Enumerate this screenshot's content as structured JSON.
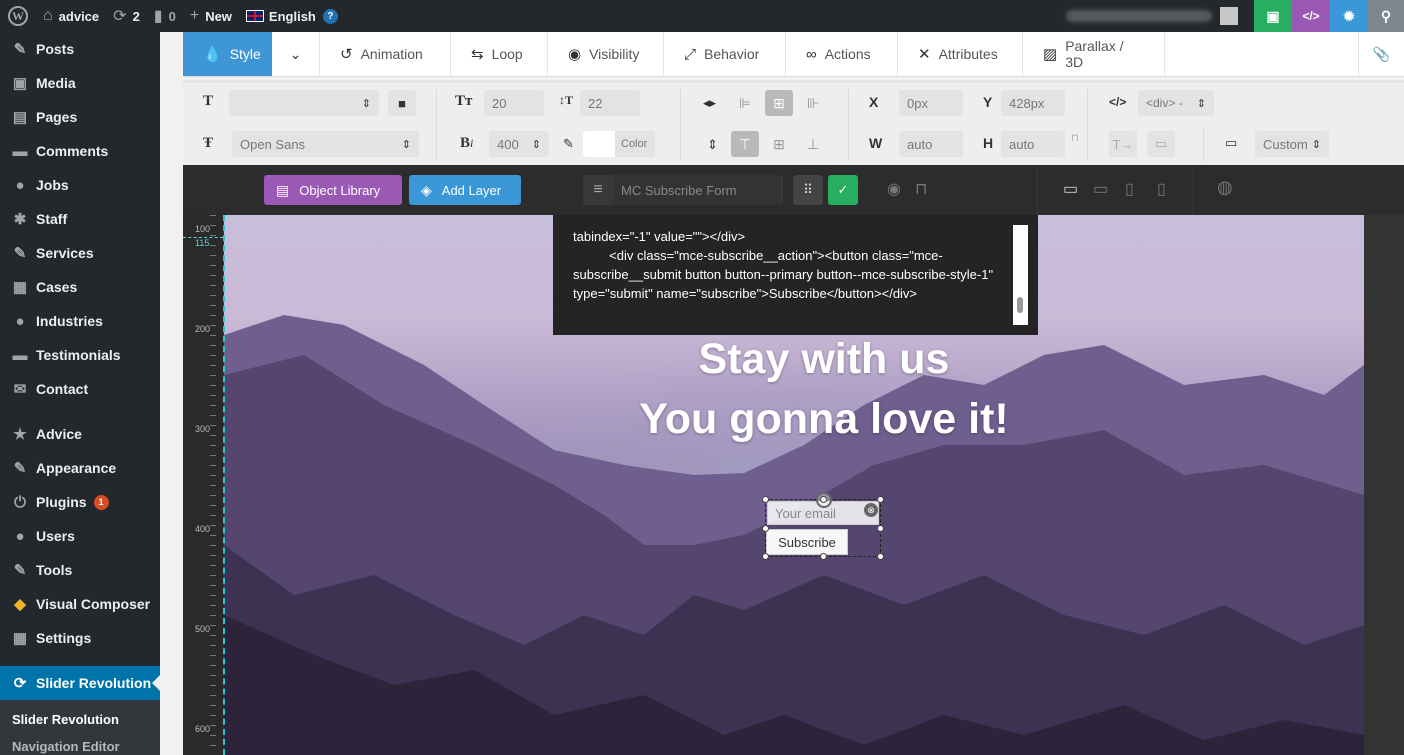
{
  "adminbar": {
    "site_name": "advice",
    "updates_count": "2",
    "comments_count": "0",
    "new_label": "New",
    "language_label": "English",
    "help_glyph": "?"
  },
  "sidebar": {
    "items": [
      {
        "label": "Posts",
        "icon": "pin-icon"
      },
      {
        "label": "Media",
        "icon": "media-icon"
      },
      {
        "label": "Pages",
        "icon": "pages-icon"
      },
      {
        "label": "Comments",
        "icon": "comments-icon"
      },
      {
        "label": "Jobs",
        "icon": "person-icon"
      },
      {
        "label": "Staff",
        "icon": "group-icon"
      },
      {
        "label": "Services",
        "icon": "wrench-icon"
      },
      {
        "label": "Cases",
        "icon": "cases-icon"
      },
      {
        "label": "Industries",
        "icon": "bulb-icon"
      },
      {
        "label": "Testimonials",
        "icon": "testimonials-icon"
      },
      {
        "label": "Contact",
        "icon": "mail-icon"
      },
      {
        "label": "Advice",
        "icon": "star-icon"
      },
      {
        "label": "Appearance",
        "icon": "brush-icon"
      },
      {
        "label": "Plugins",
        "icon": "plug-icon",
        "badge": "1"
      },
      {
        "label": "Users",
        "icon": "user-icon"
      },
      {
        "label": "Tools",
        "icon": "tools-icon"
      },
      {
        "label": "Visual Composer",
        "icon": "vc-icon"
      },
      {
        "label": "Settings",
        "icon": "settings-icon"
      }
    ],
    "current": "Slider Revolution",
    "submenu": [
      "Slider Revolution",
      "Navigation Editor"
    ]
  },
  "tabs": [
    "Style",
    "Animation",
    "Loop",
    "Visibility",
    "Behavior",
    "Actions",
    "Attributes",
    "Parallax / 3D"
  ],
  "props": {
    "font_size": "20",
    "line_height": "22",
    "font_family": "Open Sans",
    "font_weight": "400",
    "color_label": "Color",
    "x_label": "X",
    "x_value": "0px",
    "y_label": "Y",
    "y_value": "428px",
    "w_label": "W",
    "w_value": "auto",
    "h_label": "H",
    "h_value": "auto",
    "tag_select": "<div> -",
    "custom_select": "Custom"
  },
  "toolbar": {
    "object_library": "Object Library",
    "add_layer": "Add Layer",
    "layer_name": "MC Subscribe Form",
    "object_library_color": "#9b59b6",
    "add_layer_color": "#3a98d8",
    "confirm_color": "#27ae60"
  },
  "ruler": {
    "labels": [
      "100",
      "115",
      "200",
      "300",
      "400",
      "500",
      "600"
    ]
  },
  "code_popup": {
    "text": "tabindex=\"-1\" value=\"\"></div>\n          <div class=\"mce-subscribe__action\"><button class=\"mce-subscribe__submit button button--primary button--mce-subscribe-style-1\" type=\"submit\" name=\"subscribe\">Subscribe</button></div>"
  },
  "slide": {
    "headline_1": "Stay with us",
    "headline_2": "You gonna love it!",
    "email_placeholder": "Your email",
    "subscribe_label": "Subscribe"
  }
}
